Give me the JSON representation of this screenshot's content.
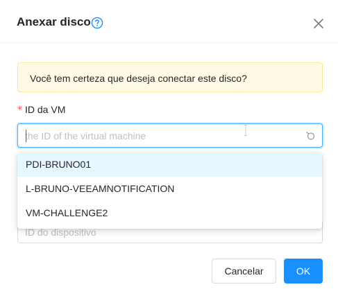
{
  "dialog": {
    "title": "Anexar disco",
    "alert_message": "Você tem certeza que deseja conectar este disco?"
  },
  "form": {
    "vm_field": {
      "required_mark": "*",
      "label": "ID da VM",
      "value": "",
      "placeholder": "the ID of the virtual machine"
    },
    "device_field": {
      "value": "",
      "placeholder": "ID do dispositivo"
    }
  },
  "dropdown": {
    "options": [
      {
        "label": "PDI-BRUNO01",
        "active": true
      },
      {
        "label": "L-BRUNO-VEEAMNOTIFICATION",
        "active": false
      },
      {
        "label": "VM-CHALLENGE2",
        "active": false
      }
    ]
  },
  "footer": {
    "cancel_label": "Cancelar",
    "ok_label": "OK"
  },
  "icons": {
    "help": "help-circle-icon",
    "close": "close-icon",
    "search": "search-icon"
  },
  "colors": {
    "primary": "#1890ff",
    "alert_background": "#fffbe6",
    "alert_border": "#ffe58f",
    "required": "#ff4d4f",
    "option_active": "#e6f7ff"
  }
}
